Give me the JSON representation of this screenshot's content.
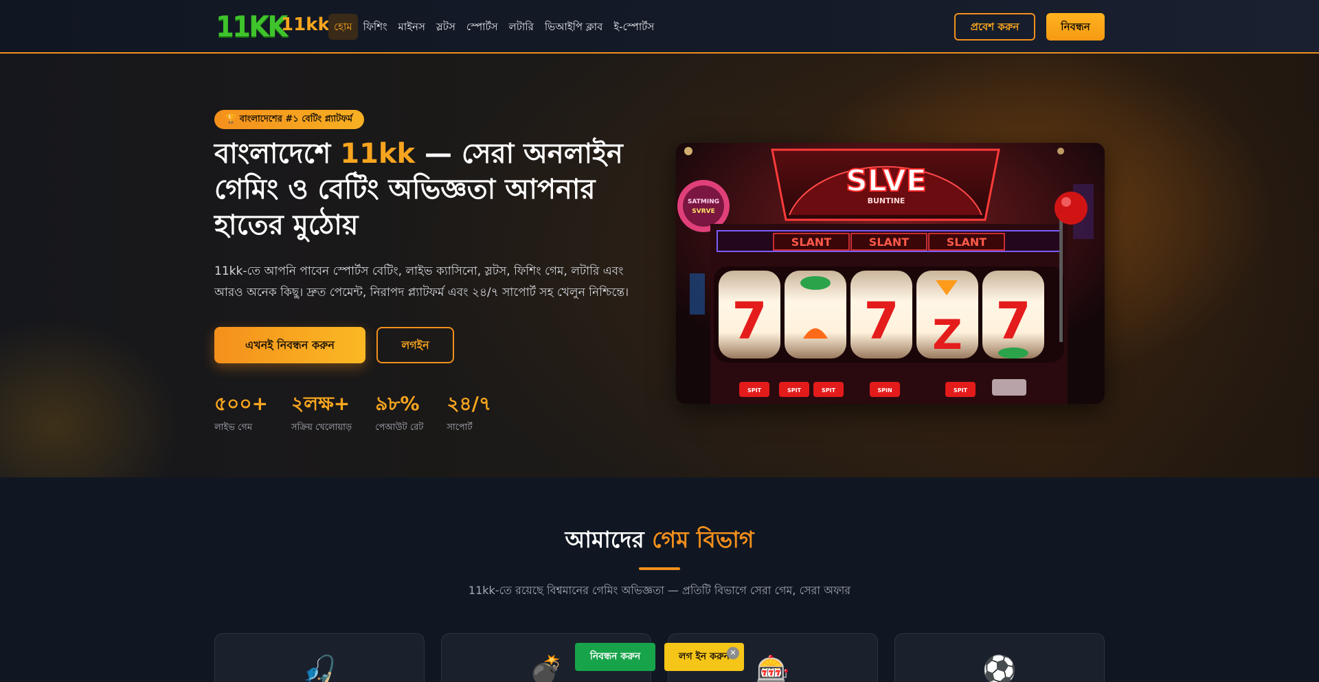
{
  "header": {
    "logo_mark": "11KK",
    "logo_text": "11kk",
    "nav": [
      {
        "label": "হোম",
        "active": true
      },
      {
        "label": "ফিশিং"
      },
      {
        "label": "মাইনস"
      },
      {
        "label": "স্লটস"
      },
      {
        "label": "স্পোর্টস"
      },
      {
        "label": "লটারি"
      },
      {
        "label": "ভিআইপি ক্লাব"
      },
      {
        "label": "ই-স্পোর্টস"
      }
    ],
    "login_label": "প্রবেশ করুন",
    "register_label": "নিবন্ধন"
  },
  "hero": {
    "badge": "🏆 বাংলাদেশের #১ বেটিং প্ল্যাটফর্ম",
    "title_prefix": "বাংলাদেশে ",
    "title_brand": "11kk",
    "title_suffix": " — সেরা অনলাইন গেমিং ও বেটিং অভিজ্ঞতা আপনার হাতের মুঠোয়",
    "description": "11kk-তে আপনি পাবেন স্পোর্টস বেটিং, লাইভ ক্যাসিনো, স্লটস, ফিশিং গেম, লটারি এবং আরও অনেক কিছু। দ্রুত পেমেন্ট, নিরাপদ প্ল্যাটফর্ম এবং ২৪/৭ সাপোর্ট সহ খেলুন নিশ্চিন্তে।",
    "cta_register": "এখনই নিবন্ধন করুন",
    "cta_login": "লগইন",
    "stats": [
      {
        "value": "৫০০+",
        "label": "লাইভ গেম"
      },
      {
        "value": "২লক্ষ+",
        "label": "সক্রিয় খেলোয়াড়"
      },
      {
        "value": "৯৮%",
        "label": "পেআউট রেট"
      },
      {
        "value": "২৪/৭",
        "label": "সাপোর্ট"
      }
    ],
    "image": {
      "sign_title": "SLVE",
      "sign_sub": "BUNTINE",
      "side_sign_1": "SATMING",
      "side_sign_2": "SVRVE",
      "reel_banner": [
        "SLANT",
        "SLANT",
        "SLANT"
      ],
      "button_labels": [
        "SPIT",
        "SPIT",
        "SPIT",
        "SPIN",
        "SPIT"
      ]
    }
  },
  "games_section": {
    "title_prefix": "আমাদের ",
    "title_accent": "গেম বিভাগ",
    "subtitle": "11kk-তে রয়েছে বিশ্বমানের গেমিং অভিজ্ঞতা — প্রতিটি বিভাগে সেরা গেম, সেরা অফার",
    "categories": [
      {
        "icon": "fishing-icon",
        "glyph": "🎣"
      },
      {
        "icon": "bomb-icon",
        "glyph": "💣"
      },
      {
        "icon": "slot-icon",
        "glyph": "🎰"
      },
      {
        "icon": "soccer-ball-icon",
        "glyph": "⚽"
      }
    ]
  },
  "floating_bar": {
    "register_label": "নিবন্ধন করুন",
    "login_label": "লগ ইন করুন",
    "close_glyph": "✕"
  },
  "colors": {
    "accent": "#f4901c",
    "accent_light": "#f7a51f",
    "logo_green": "#3fc42c",
    "background": "#111722",
    "float_green": "#17a34a",
    "float_yellow": "#f5c518"
  }
}
